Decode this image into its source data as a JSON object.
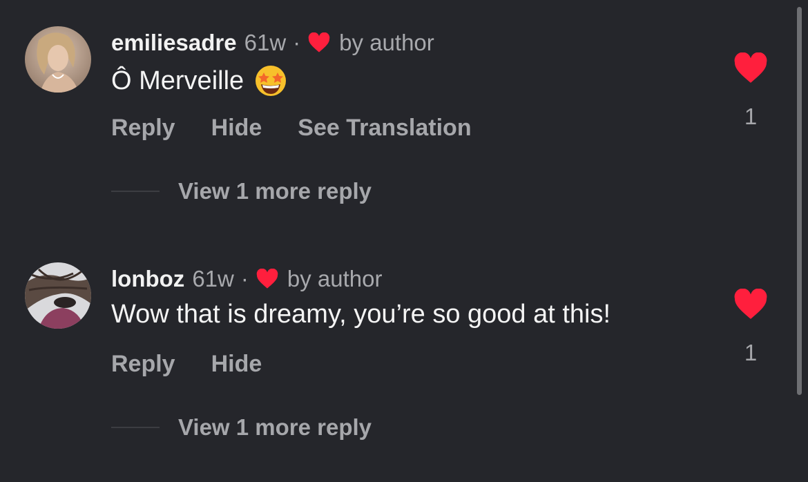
{
  "comments": [
    {
      "username": "emiliesadre",
      "time": "61w",
      "dot": "·",
      "by_author": "by author",
      "text": "Ô Merveille",
      "emoji": "star-struck-emoji",
      "actions": [
        "Reply",
        "Hide",
        "See Translation"
      ],
      "view_more": "View 1 more reply",
      "like_count": "1"
    },
    {
      "username": "lonboz",
      "time": "61w",
      "dot": "·",
      "by_author": "by author",
      "text": "Wow that is dreamy, you’re so good at this!",
      "actions": [
        "Reply",
        "Hide"
      ],
      "view_more": "View 1 more reply",
      "like_count": "1"
    }
  ],
  "colors": {
    "background": "#25262b",
    "heart": "#ff1f3d",
    "secondary_text": "#a6a7ab"
  }
}
